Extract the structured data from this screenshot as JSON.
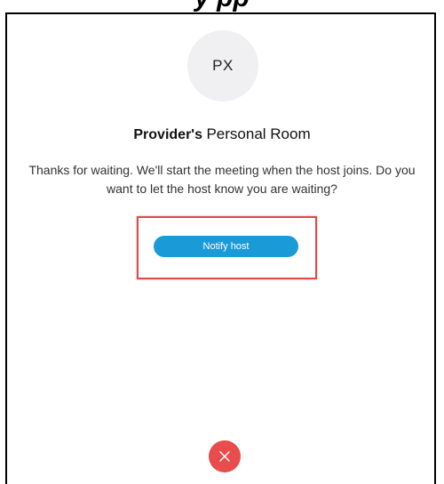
{
  "banner": {
    "partial_text": "y          pp"
  },
  "avatar": {
    "initials": "PX",
    "background_color": "#f0f0f2"
  },
  "room": {
    "owner": "Provider's",
    "name": "Personal Room"
  },
  "message": {
    "text": "Thanks for waiting. We'll start the meeting when the host joins. Do you want to let the host know you are waiting?"
  },
  "actions": {
    "notify_label": "Notify host",
    "notify_color": "#1a9bd7",
    "highlight_color": "#e04a4a",
    "leave_icon": "close-icon",
    "leave_color": "#e84c4c"
  }
}
